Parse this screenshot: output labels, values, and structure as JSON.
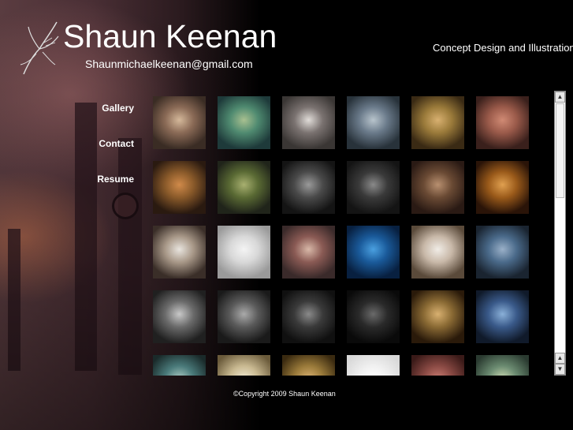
{
  "header": {
    "title": "Shaun Keenan",
    "email": "Shaunmichaelkeenan@gmail.com",
    "tagline": "Concept Design and Illustration",
    "logo_icon": "bird-sketch-icon"
  },
  "nav": {
    "items": [
      {
        "label": "Gallery"
      },
      {
        "label": "Contact"
      },
      {
        "label": "Resume"
      }
    ]
  },
  "gallery": {
    "rows": [
      [
        {
          "subject": "elephant-creature",
          "colors": [
            "#3a2c24",
            "#8a6a56",
            "#d4b89a"
          ]
        },
        {
          "subject": "green-goblin",
          "colors": [
            "#1e3a3a",
            "#4f8a70",
            "#a8c090"
          ]
        },
        {
          "subject": "creature-mask",
          "colors": [
            "#3a3634",
            "#7a7270",
            "#e0dcd8"
          ]
        },
        {
          "subject": "ape-monster",
          "colors": [
            "#28323a",
            "#6a7a8a",
            "#b8c4cc"
          ]
        },
        {
          "subject": "insect-creature",
          "colors": [
            "#3a2a14",
            "#9a7a3a",
            "#d8b070"
          ]
        },
        {
          "subject": "red-beast",
          "colors": [
            "#3a201c",
            "#9a5a4a",
            "#d08a74"
          ]
        }
      ],
      [
        {
          "subject": "rabbit-warrior",
          "colors": [
            "#2a1a10",
            "#8a5a2a",
            "#d08a4a"
          ]
        },
        {
          "subject": "green-rider",
          "colors": [
            "#20241a",
            "#5a6a34",
            "#a8b070"
          ]
        },
        {
          "subject": "grey-sketch",
          "colors": [
            "#141414",
            "#4a4a4a",
            "#9a9a9a"
          ]
        },
        {
          "subject": "grey-creature",
          "colors": [
            "#141414",
            "#3a3a3a",
            "#8a8a8a"
          ]
        },
        {
          "subject": "brown-creature",
          "colors": [
            "#2a1a14",
            "#6a4a34",
            "#b89070"
          ]
        },
        {
          "subject": "orange-armor",
          "colors": [
            "#2a1408",
            "#9a5a1a",
            "#e0a050"
          ]
        }
      ],
      [
        {
          "subject": "landscape-sketch",
          "colors": [
            "#3a2e28",
            "#a89888",
            "#e8e4de"
          ]
        },
        {
          "subject": "creature-sheet",
          "colors": [
            "#9a9a9a",
            "#d8d8d8",
            "#f4f4f4"
          ]
        },
        {
          "subject": "horned-beast",
          "colors": [
            "#3a2a2a",
            "#8a5a54",
            "#d8b8a8"
          ]
        },
        {
          "subject": "blue-dragon",
          "colors": [
            "#082040",
            "#1a5a9a",
            "#4aa0e0"
          ]
        },
        {
          "subject": "lizard-sketch",
          "colors": [
            "#5a4a3a",
            "#c8b8a8",
            "#f0ece6"
          ]
        },
        {
          "subject": "blue-face",
          "colors": [
            "#1a2430",
            "#4a6a8a",
            "#9ab0c8"
          ]
        }
      ],
      [
        {
          "subject": "grey-rabbit",
          "colors": [
            "#202020",
            "#6a6a6a",
            "#c8c8c8"
          ]
        },
        {
          "subject": "grey-ship",
          "colors": [
            "#1a1a1a",
            "#5a5a5a",
            "#aaaaaa"
          ]
        },
        {
          "subject": "dark-machine",
          "colors": [
            "#101010",
            "#3a3a3a",
            "#8a8a8a"
          ]
        },
        {
          "subject": "dark-scene",
          "colors": [
            "#0a0a0a",
            "#2a2a2a",
            "#6a6a6a"
          ]
        },
        {
          "subject": "gold-wizard",
          "colors": [
            "#2a1a0a",
            "#8a6a34",
            "#d8b070"
          ]
        },
        {
          "subject": "blue-gorilla",
          "colors": [
            "#101a2a",
            "#3a5a8a",
            "#8ab0d8"
          ]
        }
      ],
      [
        {
          "subject": "teal-scene",
          "colors": [
            "#1a2a2a",
            "#4a7a7a",
            "#a8c8c0"
          ]
        },
        {
          "subject": "pale-creature",
          "colors": [
            "#6a5a3a",
            "#c8b890",
            "#f0e8d0"
          ]
        },
        {
          "subject": "leopard",
          "colors": [
            "#3a2a10",
            "#9a7a3a",
            "#d8b070"
          ]
        },
        {
          "subject": "white-sketch",
          "colors": [
            "#d8d8d8",
            "#f0f0f0",
            "#ffffff"
          ]
        },
        {
          "subject": "red-figure",
          "colors": [
            "#3a1a18",
            "#8a4a44",
            "#c87a70"
          ]
        },
        {
          "subject": "teal-creature",
          "colors": [
            "#2a3a30",
            "#6a8a70",
            "#c8d8b0"
          ]
        }
      ]
    ]
  },
  "scrollbar": {
    "up_icon": "arrow-up-icon",
    "down_icon": "arrow-down-icon"
  },
  "footer": {
    "copyright": "©Copyright 2009 Shaun Keenan"
  }
}
